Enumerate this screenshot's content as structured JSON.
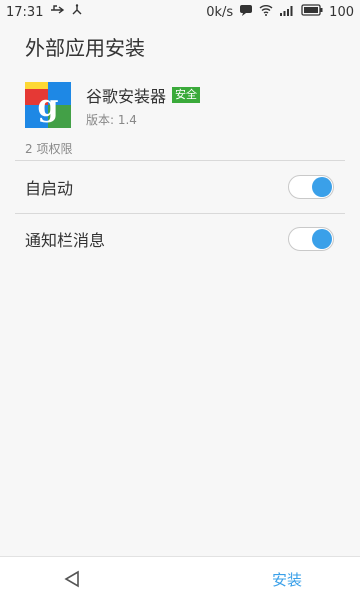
{
  "status": {
    "time": "17:31",
    "speed": "0k/s",
    "battery": "100",
    "icons": [
      "usb-icon",
      "network-icon",
      "message-icon",
      "wifi-icon",
      "signal-icon",
      "battery-icon"
    ]
  },
  "header": {
    "title": "外部应用安装"
  },
  "app": {
    "name": "谷歌安装器",
    "badge": "安全",
    "version": "版本: 1.4",
    "icon": "google-installer-icon",
    "colors": {
      "red": "#e53935",
      "blue": "#1e88e5",
      "green": "#43a047",
      "yellow": "#fdd835"
    }
  },
  "permissions": {
    "count_label": "2 项权限",
    "items": [
      {
        "label": "自启动",
        "enabled": true
      },
      {
        "label": "通知栏消息",
        "enabled": true
      }
    ]
  },
  "bottom": {
    "install_label": "安装",
    "back_icon": "back-triangle-icon"
  },
  "colors": {
    "accent": "#3aa0e9",
    "safe_badge": "#3aaa3a"
  }
}
